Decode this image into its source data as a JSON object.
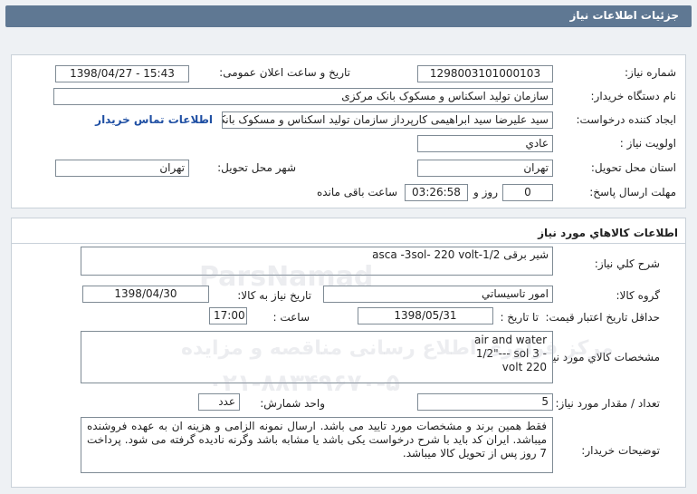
{
  "page": {
    "title": "جزئیات اطلاعات نیاز"
  },
  "top": {
    "need_number": {
      "label": "شماره نیاز:",
      "value": "1298003101000103"
    },
    "announce_datetime": {
      "label": "تاریخ و ساعت اعلان عمومی:",
      "value": "1398/04/27 - 15:43"
    },
    "buyer_org": {
      "label": "نام دستگاه خریدار:",
      "value": "سازمان تولید اسکناس و مسکوک بانک مرکزی"
    },
    "requester": {
      "label": "ایجاد کننده درخواست:",
      "value": "سید علیرضا سید ابراهیمی کارپرداز سازمان تولید اسکناس و مسکوک بانک مرکزی"
    },
    "contact_link": "اطلاعات تماس خریدار",
    "priority": {
      "label": "اولویت نیاز :",
      "value": "عادي"
    },
    "delivery_province": {
      "label": "استان محل تحویل:",
      "value": "تهران"
    },
    "delivery_city": {
      "label": "شهر محل تحویل:",
      "value": "تهران"
    },
    "reply_deadline": {
      "label": "مهلت ارسال پاسخ:",
      "days_value": "0",
      "days_suffix": "روز و",
      "time_value": "03:26:58",
      "remaining_label": "ساعت باقی مانده"
    }
  },
  "goods": {
    "section_title": "اطلاعات کالاهاي مورد نياز",
    "summary": {
      "label": "شرح کلي نياز:",
      "value": "شیر برقی 1/2-asca  -3sol- 220 volt"
    },
    "goods_group": {
      "label": "گروه کالا:",
      "value": "امور تاسیساتي"
    },
    "need_date": {
      "label": "تاریخ نیاز به کالا:",
      "value": "1398/04/30"
    },
    "price_validity": {
      "label": "حداقل تاریخ اعتبار قیمت:",
      "to_date_label": "تا تاریخ :",
      "date_value": "1398/05/31",
      "time_label": "ساعت :",
      "time_value": "17:00"
    },
    "specs": {
      "label": "مشخصات کالاي مورد نياز:",
      "lines": [
        "air and water",
        "1/2\"--- sol 3 -",
        "volt  220"
      ]
    },
    "quantity": {
      "label": "تعداد / مقدار مورد نیاز:",
      "value": "5"
    },
    "unit": {
      "label": "واحد شمارش:",
      "value": "عدد"
    },
    "buyer_notes": {
      "label": "توضیحات خریدار:",
      "text": "فقط همین برند و مشخصات مورد تایید می باشد. ارسال نمونه الزامی و هزینه ان به عهده فروشنده میباشد. ایران کد باید با شرح درخواست یکی باشد یا مشابه باشد وگرنه نادیده گرفته می شود. پرداخت 7 روز پس از تحویل کالا میباشد."
    }
  },
  "watermark": {
    "brand": "ParsNamad",
    "line1": "مرکز فراوری اطلاع رسانی مناقصه و مزایده",
    "line2": "۰۲۱-۸۸۳۴۹۶۷۰-۵"
  }
}
